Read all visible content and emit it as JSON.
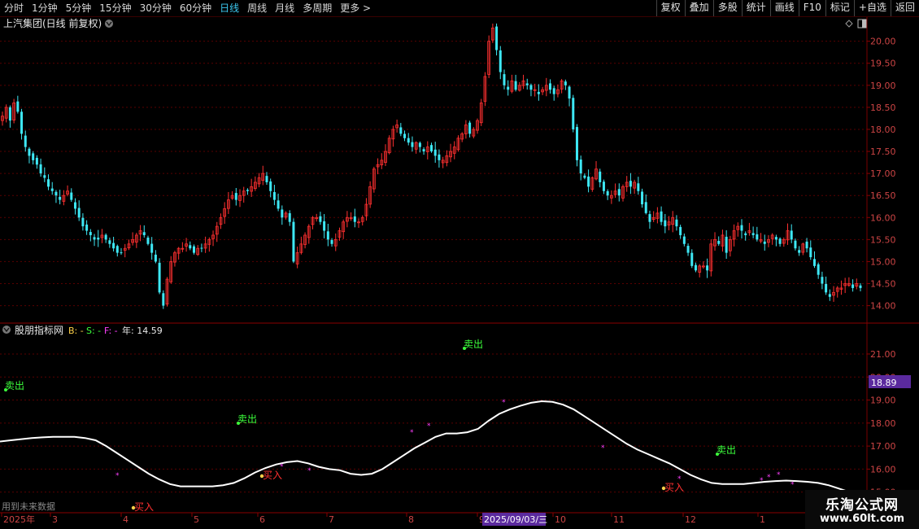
{
  "toolbar": {
    "periods": [
      "分时",
      "1分钟",
      "5分钟",
      "15分钟",
      "30分钟",
      "60分钟",
      "日线",
      "周线",
      "月线",
      "多周期",
      "更多 >"
    ],
    "active_period": "日线",
    "right_buttons": [
      "复权",
      "叠加",
      "多股",
      "统计",
      "画线",
      "F10",
      "标记",
      "+自选",
      "返回"
    ]
  },
  "main_panel": {
    "title": "上汽集团(日线 前复权)",
    "y_ticks": [
      "20.00",
      "19.50",
      "19.00",
      "18.50",
      "18.00",
      "17.50",
      "17.00",
      "16.50",
      "16.00",
      "15.50",
      "15.00",
      "14.50",
      "14.00"
    ]
  },
  "indicator_panel": {
    "name": "股朋指标网",
    "b_label": "B: -",
    "s_label": "S: -",
    "f_label": "F: -",
    "year_label": "年: 14.59",
    "y_ticks": [
      "21.00",
      "20.00",
      "19.00",
      "18.00",
      "17.00",
      "16.00",
      "15.00"
    ],
    "current_value": "18.89",
    "future_note": "用到未来数据",
    "buy_label": "买入",
    "sell_label": "卖出"
  },
  "x_axis": {
    "labels": [
      "2025年",
      "3",
      "4",
      "5",
      "6",
      "7",
      "8",
      "9",
      "10",
      "11",
      "12",
      "1"
    ],
    "cursor_date": "2025/09/03/三"
  },
  "watermark": {
    "line1": "乐淘公式网",
    "line2": "www.60lt.com"
  },
  "colors": {
    "up": "#ff3030",
    "down": "#3ee8f5",
    "grid": "#5a0000",
    "line": "#ffffff",
    "sell": "#3cff3c",
    "buy": "#ff3030",
    "dot": "#ff40ff",
    "badge": "#5b2a9e"
  },
  "chart_data": {
    "type": "candlestick",
    "ylim": [
      13.9,
      20.4
    ],
    "closes": [
      18.3,
      18.5,
      18.2,
      18.6,
      18.4,
      17.9,
      17.6,
      17.4,
      17.3,
      17.2,
      17.0,
      16.9,
      16.7,
      16.6,
      16.5,
      16.4,
      16.5,
      16.6,
      16.4,
      16.2,
      16.0,
      15.8,
      15.7,
      15.6,
      15.5,
      15.5,
      15.6,
      15.5,
      15.4,
      15.3,
      15.2,
      15.2,
      15.3,
      15.4,
      15.5,
      15.6,
      15.7,
      15.6,
      15.4,
      15.2,
      15.0,
      14.3,
      14.0,
      14.6,
      15.0,
      15.2,
      15.3,
      15.3,
      15.4,
      15.3,
      15.2,
      15.3,
      15.3,
      15.4,
      15.5,
      15.6,
      15.8,
      16.0,
      16.2,
      16.4,
      16.5,
      16.4,
      16.5,
      16.6,
      16.6,
      16.7,
      16.8,
      16.9,
      17.0,
      16.8,
      16.6,
      16.4,
      16.2,
      16.0,
      16.1,
      15.9,
      15.0,
      15.2,
      15.4,
      15.6,
      15.8,
      16.0,
      16.0,
      15.9,
      15.7,
      15.5,
      15.4,
      15.5,
      15.7,
      15.9,
      16.0,
      16.0,
      15.9,
      15.9,
      16.0,
      16.3,
      16.7,
      17.1,
      17.2,
      17.3,
      17.5,
      17.8,
      18.0,
      18.1,
      17.9,
      17.8,
      17.7,
      17.6,
      17.7,
      17.6,
      17.5,
      17.6,
      17.5,
      17.4,
      17.3,
      17.3,
      17.4,
      17.5,
      17.6,
      17.8,
      17.9,
      18.1,
      17.9,
      18.0,
      18.2,
      18.6,
      19.2,
      20.0,
      20.3,
      19.8,
      19.3,
      19.0,
      18.9,
      19.1,
      18.9,
      19.0,
      19.1,
      19.0,
      18.9,
      18.9,
      18.8,
      18.9,
      19.0,
      18.9,
      18.8,
      18.9,
      19.1,
      19.0,
      18.7,
      18.0,
      17.3,
      17.0,
      16.9,
      16.7,
      16.9,
      17.1,
      16.8,
      16.6,
      16.5,
      16.5,
      16.6,
      16.5,
      16.7,
      16.8,
      16.7,
      16.8,
      16.6,
      16.3,
      16.1,
      15.9,
      16.0,
      16.1,
      15.9,
      15.8,
      15.9,
      16.0,
      15.8,
      15.6,
      15.4,
      15.2,
      14.9,
      14.8,
      14.9,
      14.9,
      14.8,
      15.4,
      15.5,
      15.4,
      15.6,
      15.2,
      15.5,
      15.7,
      15.8,
      15.7,
      15.6,
      15.7,
      15.6,
      15.5,
      15.5,
      15.4,
      15.5,
      15.6,
      15.5,
      15.4,
      15.5,
      15.7,
      15.5,
      15.3,
      15.2,
      15.4,
      15.3,
      15.1,
      14.9,
      14.7,
      14.5,
      14.3,
      14.2,
      14.3,
      14.4,
      14.4,
      14.5,
      14.5,
      14.4,
      14.5,
      14.4
    ],
    "indicator_line": [
      17.2,
      17.25,
      17.3,
      17.35,
      17.38,
      17.4,
      17.4,
      17.4,
      17.35,
      17.25,
      17.0,
      16.7,
      16.4,
      16.1,
      15.8,
      15.55,
      15.35,
      15.25,
      15.25,
      15.25,
      15.25,
      15.3,
      15.4,
      15.6,
      15.85,
      16.05,
      16.2,
      16.3,
      16.35,
      16.25,
      16.1,
      16.0,
      15.95,
      15.8,
      15.75,
      15.8,
      16.0,
      16.3,
      16.6,
      16.9,
      17.15,
      17.4,
      17.55,
      17.55,
      17.6,
      17.75,
      18.1,
      18.4,
      18.6,
      18.75,
      18.88,
      18.95,
      18.92,
      18.8,
      18.6,
      18.3,
      18.0,
      17.7,
      17.4,
      17.1,
      16.85,
      16.65,
      16.45,
      16.25,
      16.0,
      15.75,
      15.55,
      15.4,
      15.35,
      15.35,
      15.35,
      15.4,
      15.45,
      15.48,
      15.5,
      15.48,
      15.45,
      15.4,
      15.3,
      15.15,
      15.0,
      14.9
    ]
  }
}
